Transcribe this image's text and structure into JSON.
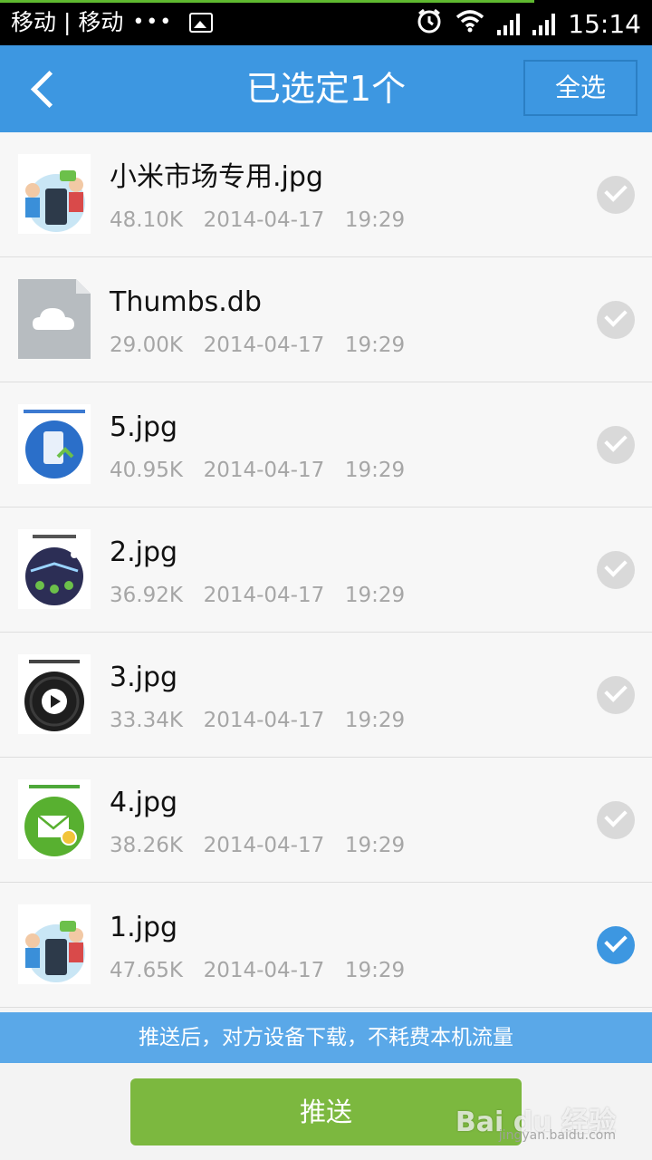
{
  "status_bar": {
    "carrier": "移动 | 移动",
    "dots": "•••",
    "time": "15:14"
  },
  "header": {
    "title": "已选定1个",
    "select_all_label": "全选"
  },
  "files": [
    {
      "name": "小米市场专用.jpg",
      "size": "48.10K",
      "date": "2014-04-17",
      "time": "19:29",
      "checked": false,
      "thumb": "people-phone"
    },
    {
      "name": "Thumbs.db",
      "size": "29.00K",
      "date": "2014-04-17",
      "time": "19:29",
      "checked": false,
      "thumb": "cloud-file"
    },
    {
      "name": "5.jpg",
      "size": "40.95K",
      "date": "2014-04-17",
      "time": "19:29",
      "checked": false,
      "thumb": "blue-phone-upload"
    },
    {
      "name": "2.jpg",
      "size": "36.92K",
      "date": "2014-04-17",
      "time": "19:29",
      "checked": false,
      "thumb": "dark-circle-ship"
    },
    {
      "name": "3.jpg",
      "size": "33.34K",
      "date": "2014-04-17",
      "time": "19:29",
      "checked": false,
      "thumb": "play-button"
    },
    {
      "name": "4.jpg",
      "size": "38.26K",
      "date": "2014-04-17",
      "time": "19:29",
      "checked": false,
      "thumb": "green-mail"
    },
    {
      "name": "1.jpg",
      "size": "47.65K",
      "date": "2014-04-17",
      "time": "19:29",
      "checked": true,
      "thumb": "people-phone"
    }
  ],
  "tip": "推送后，对方设备下载，不耗费本机流量",
  "push_button_label": "推送",
  "watermark": {
    "logo": "Bai du 经验",
    "url": "jingyan.baidu.com"
  },
  "colors": {
    "header": "#3d97e1",
    "push": "#7cb83f",
    "tip": "#5aa8e8",
    "checked": "#3d97e1"
  }
}
